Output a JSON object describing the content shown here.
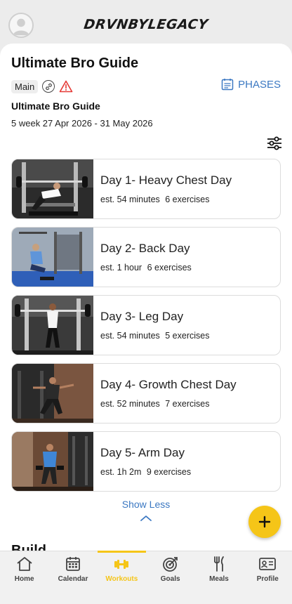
{
  "header": {
    "brand": "DRVNBYLEGACY",
    "avatar_icon": "user-avatar-icon"
  },
  "plan": {
    "title": "Ultimate Bro Guide",
    "tag": "Main",
    "phases_label": "PHASES",
    "subtitle": "Ultimate Bro Guide",
    "dates": "5 week 27 Apr 2026 - 31 May 2026"
  },
  "workouts": [
    {
      "title": "Day 1- Heavy Chest Day",
      "duration": "est. 54 minutes",
      "exercises": "6 exercises"
    },
    {
      "title": "Day 2- Back Day",
      "duration": "est. 1 hour",
      "exercises": "6 exercises"
    },
    {
      "title": "Day 3- Leg Day",
      "duration": "est. 54 minutes",
      "exercises": "5 exercises"
    },
    {
      "title": "Day 4- Growth Chest Day",
      "duration": "est. 52 minutes",
      "exercises": "7 exercises"
    },
    {
      "title": "Day 5- Arm Day",
      "duration": "est. 1h 2m",
      "exercises": "9 exercises"
    }
  ],
  "show_less": "Show Less",
  "partial_heading": "Build",
  "nav": {
    "home": "Home",
    "calendar": "Calendar",
    "workouts": "Workouts",
    "goals": "Goals",
    "meals": "Meals",
    "profile": "Profile"
  },
  "colors": {
    "accent": "#f5c518",
    "link": "#3b78c2",
    "warning": "#e53935"
  }
}
